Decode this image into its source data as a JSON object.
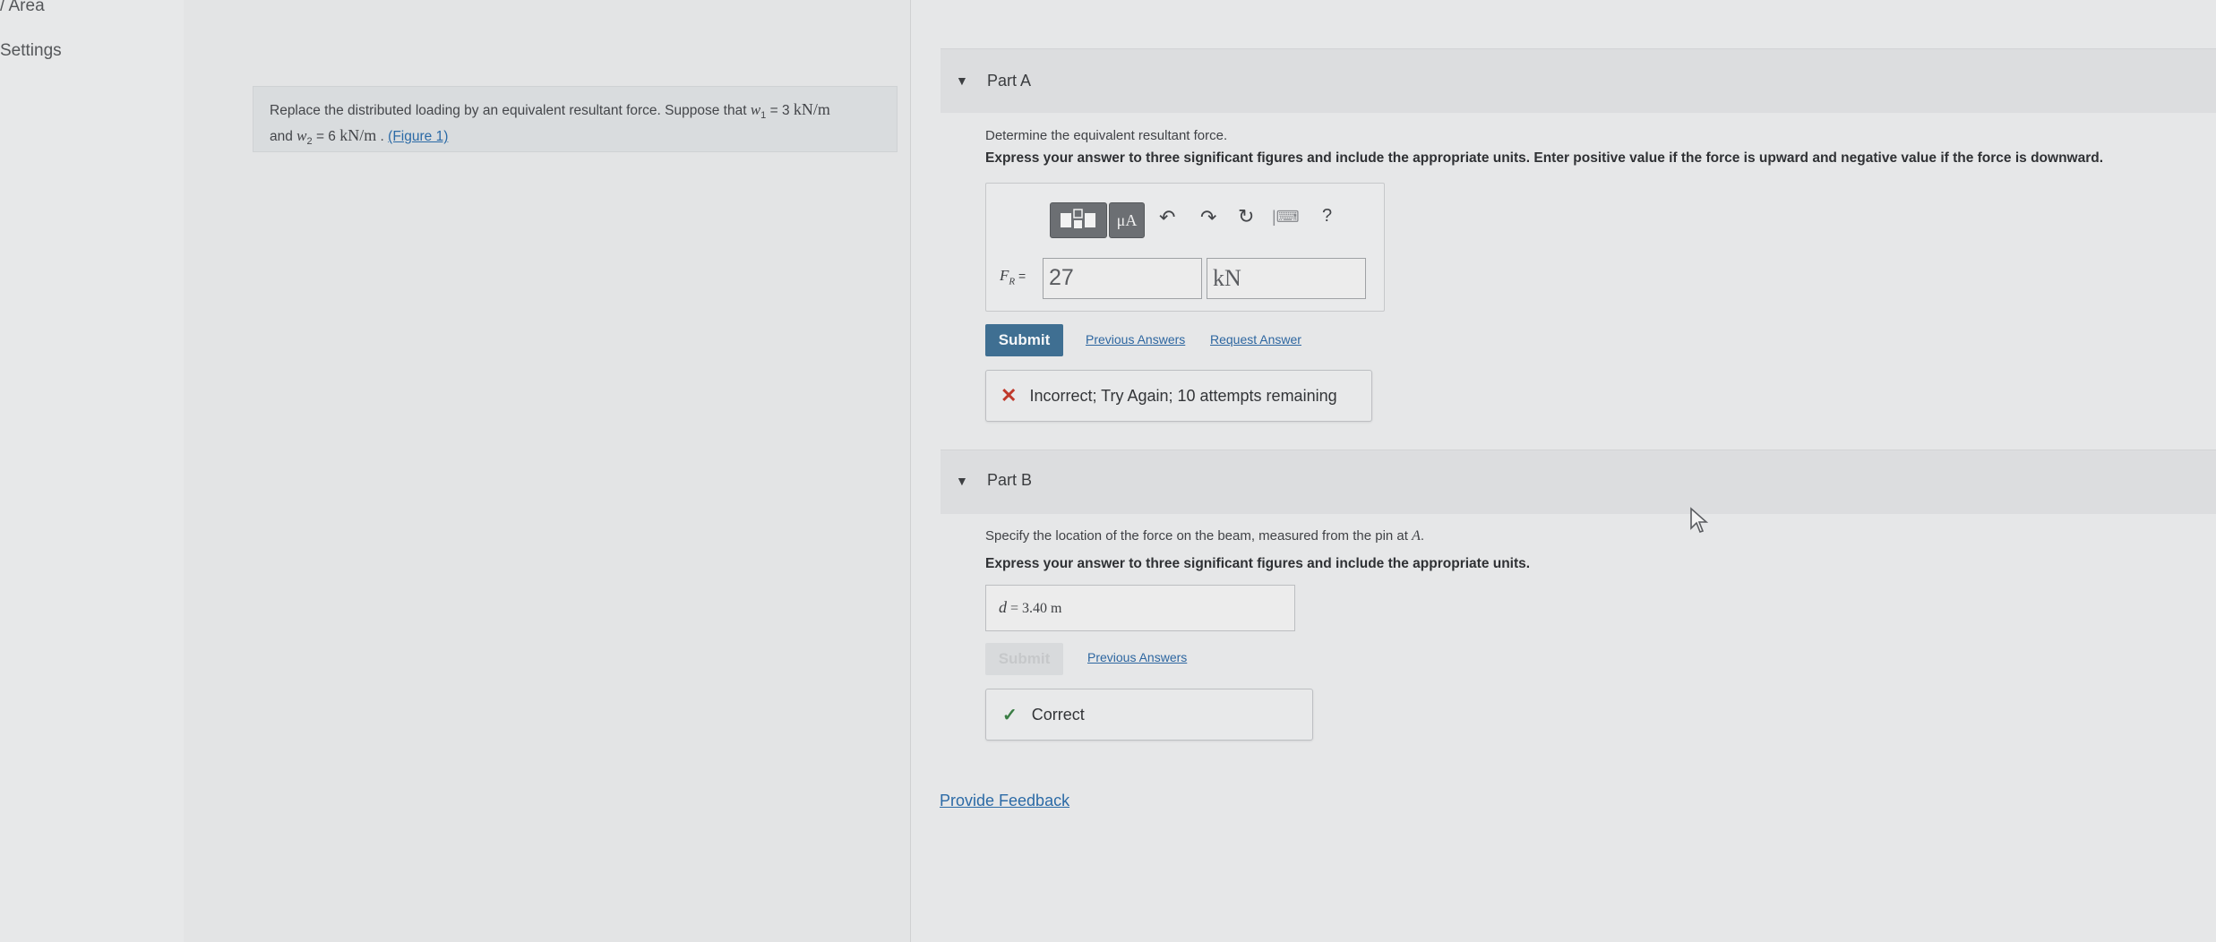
{
  "nav": {
    "area_label": "/ Area",
    "settings_label": "Settings"
  },
  "problem": {
    "text_intro": "Replace the distributed loading by an equivalent resultant force. Suppose that ",
    "w1_symbol": "w",
    "w1_sub": "1",
    "w1_eq": " = 3 ",
    "w1_unit": "kN/m",
    "and_text": "and ",
    "w2_symbol": "w",
    "w2_sub": "2",
    "w2_eq": " = 6 ",
    "w2_unit": "kN/m",
    "period": " . ",
    "figure_link": "(Figure 1)"
  },
  "part_a": {
    "title": "Part A",
    "prompt": "Determine the equivalent resultant force.",
    "instructions": "Express your answer to three significant figures and include the appropriate units. Enter positive value if the force is upward and negative value if the force is downward.",
    "toolbar": {
      "template_icon": "template-icon",
      "units_label": "μA",
      "undo_icon": "undo-icon",
      "redo_icon": "redo-icon",
      "reset_icon": "reset-icon",
      "keyboard_icon": "keyboard-icon",
      "help_label": "?"
    },
    "variable_label": "F",
    "variable_sub": "R",
    "equals": " =",
    "value": "27",
    "unit": "kN",
    "submit_label": "Submit",
    "previous_answers": "Previous Answers",
    "request_answer": "Request Answer",
    "feedback": "Incorrect; Try Again; 10 attempts remaining",
    "feedback_icon": "x-icon"
  },
  "part_b": {
    "title": "Part B",
    "prompt_pre": "Specify the location of the force on the beam, measured from the pin at ",
    "prompt_var": "A",
    "prompt_post": ".",
    "instructions": "Express your answer to three significant figures and include the appropriate units.",
    "answer_var": "d",
    "answer_eq": " =  3.40 m",
    "submit_label": "Submit",
    "previous_answers": "Previous Answers",
    "feedback": "Correct",
    "feedback_icon": "check-icon"
  },
  "provide_feedback": "Provide Feedback",
  "colors": {
    "submit": "#3f6f92",
    "link": "#2b6aa6",
    "incorrect": "#c0392b",
    "correct": "#3a7d44"
  }
}
